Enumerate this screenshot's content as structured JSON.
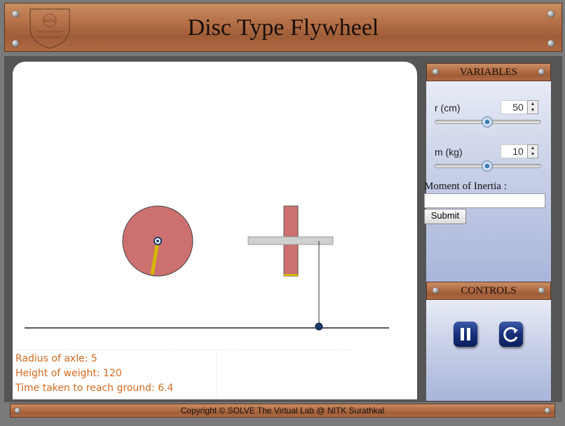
{
  "header": {
    "title": "Disc Type Flywheel",
    "logo_text": "NITK"
  },
  "variables": {
    "heading": "VARIABLES",
    "r": {
      "label": "r (cm)",
      "value": "50",
      "slider_fraction": 0.5
    },
    "m": {
      "label": "m (kg)",
      "value": "10",
      "slider_fraction": 0.5
    },
    "moi_label": "Moment of Inertia :",
    "moi_value": "",
    "submit_label": "Submit"
  },
  "controls": {
    "heading": "CONTROLS",
    "pause_icon": "pause-icon",
    "reset_icon": "reset-icon"
  },
  "info": {
    "radius_of_axle": "Radius of axle: 5",
    "height_of_weight": "Height of weight: 120",
    "time_taken": "Time taken to reach ground: 6.4"
  },
  "footer": {
    "copyright": "Copyright © SOLVE The Virtual Lab @ NITK Surathkal"
  },
  "colors": {
    "disc": "#cd7070",
    "arm": "#d4b800",
    "accent": "#b8734a"
  }
}
